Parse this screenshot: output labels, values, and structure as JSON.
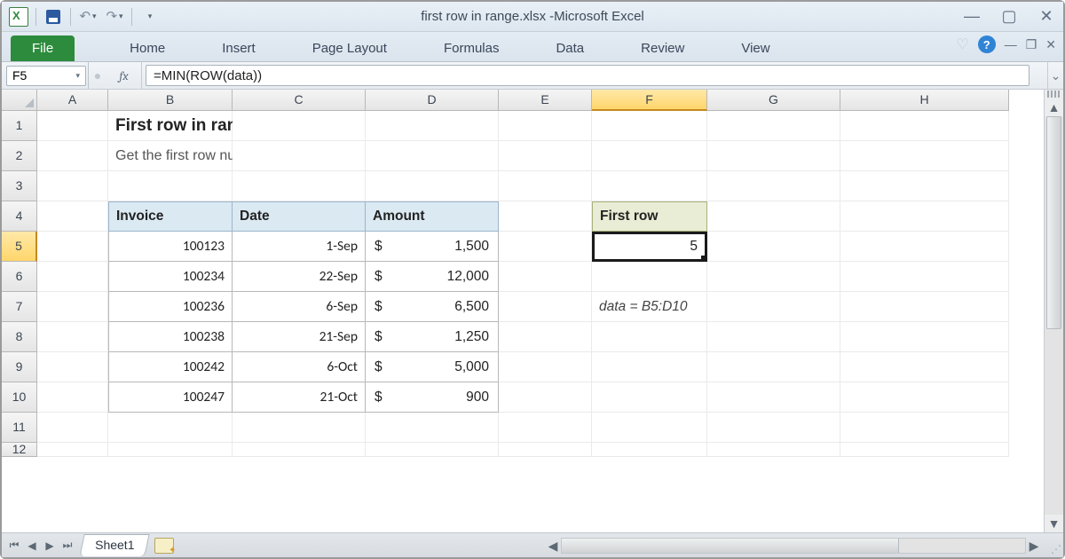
{
  "window": {
    "filename": "first row in range.xlsx",
    "app": "Microsoft Excel"
  },
  "qat": {
    "undo_glyph": "↶",
    "redo_glyph": "↷"
  },
  "ribbon": {
    "file": "File",
    "tabs": [
      "Home",
      "Insert",
      "Page Layout",
      "Formulas",
      "Data",
      "Review",
      "View"
    ]
  },
  "formula_bar": {
    "name_box": "F5",
    "fx": "fx",
    "formula": "=MIN(ROW(data))"
  },
  "columns": [
    "A",
    "B",
    "C",
    "D",
    "E",
    "F",
    "G",
    "H"
  ],
  "selected_col": "F",
  "rows": [
    "1",
    "2",
    "3",
    "4",
    "5",
    "6",
    "7",
    "8",
    "9",
    "10",
    "11",
    "12"
  ],
  "selected_row": "5",
  "content": {
    "title": "First row in range",
    "subtitle": "Get the first row number in the range",
    "headers": {
      "invoice": "Invoice",
      "date": "Date",
      "amount": "Amount"
    },
    "data": [
      {
        "invoice": "100123",
        "date": "1-Sep",
        "sym": "$",
        "amount": "1,500"
      },
      {
        "invoice": "100234",
        "date": "22-Sep",
        "sym": "$",
        "amount": "12,000"
      },
      {
        "invoice": "100236",
        "date": "6-Sep",
        "sym": "$",
        "amount": "6,500"
      },
      {
        "invoice": "100238",
        "date": "21-Sep",
        "sym": "$",
        "amount": "1,250"
      },
      {
        "invoice": "100242",
        "date": "6-Oct",
        "sym": "$",
        "amount": "5,000"
      },
      {
        "invoice": "100247",
        "date": "21-Oct",
        "sym": "$",
        "amount": "900"
      }
    ],
    "result_header": "First row",
    "result_value": "5",
    "note": "data = B5:D10"
  },
  "sheet_tab": "Sheet1"
}
